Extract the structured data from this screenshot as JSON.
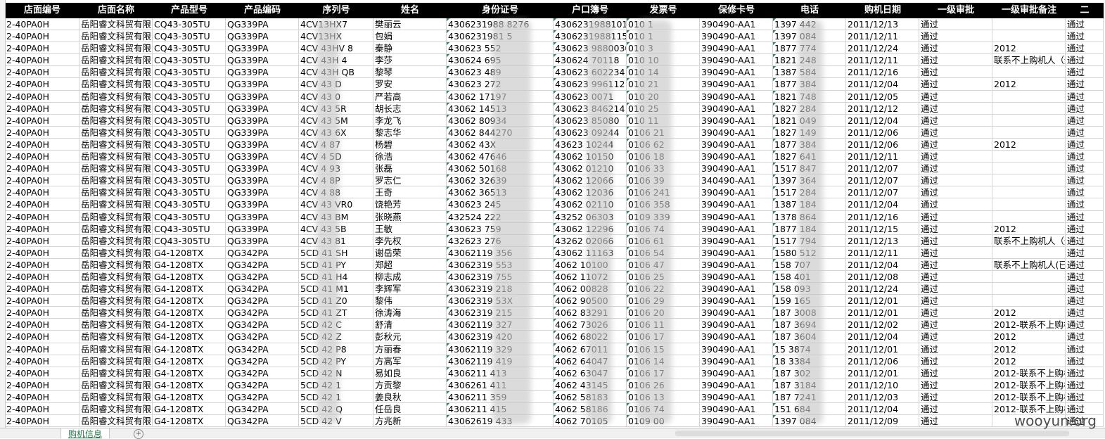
{
  "columns": [
    "店面编号",
    "店面名称",
    "产品型号",
    "产品编码",
    "序列号",
    "姓名",
    "身份证号",
    "户口簿号",
    "发票号",
    "保修卡号",
    "电话",
    "购机日期",
    "一级审批",
    "一级审批备注",
    "二"
  ],
  "rows": [
    [
      "2-40PA0H",
      "岳阳睿文科贸有限",
      "CQ43-305TU",
      "QG339PA",
      "4CV13HX7",
      "樊丽云",
      "4306231988  8276",
      "430623198810182",
      "010  1",
      "390490-AA1",
      "1397   442",
      "2011/12/13",
      "通过",
      "",
      "通过"
    ],
    [
      "2-40PA0H",
      "岳阳睿文科贸有限",
      "CQ43-305TU",
      "QG339PA",
      "4CV13HX",
      "包娟",
      "4306231981  5",
      "430623198811563",
      "010  1",
      "390490-AA1",
      "1397   084",
      "2011/12/11",
      "通过",
      "",
      "通过"
    ],
    [
      "2-40PA0H",
      "岳阳睿文科贸有限",
      "CQ43-305TU",
      "QG339PA",
      "4CV 43HV 8",
      "秦静",
      "430623  552",
      "430623  9880030",
      "010  3",
      "390490-AA1",
      "1877   774",
      "2011/12/24",
      "通过",
      "2012",
      "通过"
    ],
    [
      "2-40PA0H",
      "岳阳睿文科贸有限",
      "CQ43-305TU",
      "QG339PA",
      "4CV 43H 4",
      "李莎",
      "430624  695",
      "430624  70118",
      "010  10",
      "390490-AA1",
      "1821   248",
      "2011/12/11",
      "通过",
      "联系不上购机人（通",
      "通过"
    ],
    [
      "2-40PA0H",
      "岳阳睿文科贸有限",
      "CQ43-305TU",
      "QG339PA",
      "4CV 43H QB",
      "黎琴",
      "430623  489",
      "430623  602234",
      "010  14",
      "390490-AA1",
      "1387   584",
      "2011/12/16",
      "通过",
      "",
      "通过"
    ],
    [
      "2-40PA0H",
      "岳阳睿文科贸有限",
      "CQ43-305TU",
      "QG339PA",
      "4CV 43  D",
      "罗安",
      "430623  272",
      "430623  996112",
      "010  21",
      "390490-AA1",
      "1877   384",
      "2011/12/04",
      "通过",
      "2012",
      "通过"
    ],
    [
      "2-40PA0H",
      "岳阳睿文科贸有限",
      "CQ43-305TU",
      "QG339PA",
      "4CV 43  0",
      "严若高",
      "43062  17197",
      "430623  0071",
      "010  20",
      "390490-AA1",
      "1821   748",
      "2011/12/05",
      "通过",
      "",
      "通过"
    ],
    [
      "2-40PA0H",
      "岳阳睿文科贸有限",
      "CQ43-305TU",
      "QG339PA",
      "4CV 43  5R",
      "胡长志",
      "43062  14513",
      "430623  846214",
      "010  25",
      "390490-AA1",
      "1827   284",
      "2011/12/12",
      "通过",
      "",
      "通过"
    ],
    [
      "2-40PA0H",
      "岳阳睿文科贸有限",
      "CQ43-305TU",
      "QG339PA",
      "4CV 43  5M",
      "李龙飞",
      "43062  80934",
      "430623  85080",
      "010  11",
      "390490-AA1",
      "1821   049",
      "2011/12/04",
      "通过",
      "",
      "通过"
    ],
    [
      "2-40PA0H",
      "岳阳睿文科贸有限",
      "CQ43-305TU",
      "QG339PA",
      "4CV 43  6X",
      "黎志华",
      "43062  844270",
      "430623  09244",
      "0106  21",
      "390490-AA1",
      "1827   149",
      "2011/12/06",
      "通过",
      "",
      "通过"
    ],
    [
      "2-40PA0H",
      "岳阳睿文科贸有限",
      "CQ43-305TU",
      "QG339PA",
      "4CV 4  87",
      "杨碧",
      "43062  43X",
      "43623  10244",
      "0106  62",
      "390490-AA1",
      "1877   384",
      "2011/12/06",
      "通过",
      "2012",
      "通过"
    ],
    [
      "2-40PA0H",
      "岳阳睿文科贸有限",
      "CQ43-305TU",
      "QG339PA",
      "4CV 4  5D",
      "徐浩",
      "43062  47646",
      "43062  10150",
      "0106  18",
      "390490-AA1",
      "1827   641",
      "2011/12/11",
      "通过",
      "",
      "通过"
    ],
    [
      "2-40PA0H",
      "岳阳睿文科贸有限",
      "CQ43-305TU",
      "QG339PA",
      "4CV 4  93",
      "张磊",
      "43062  50168",
      "43062  01210",
      "0106  33",
      "390490-AA1",
      "1517   847",
      "2011/12/07",
      "通过",
      "",
      "通过"
    ],
    [
      "2-40PA0H",
      "岳阳睿文科贸有限",
      "CQ43-305TU",
      "QG339PA",
      "4CV 4  8P",
      "罗志仁",
      "43062  32639",
      "43062  12066",
      "0106  39",
      "340490-AA1",
      "1397   364",
      "2011/12/07",
      "通过",
      "",
      "通过"
    ],
    [
      "2-40PA0H",
      "岳阳睿文科贸有限",
      "CQ43-305TU",
      "QG339PA",
      "4CV 4  88",
      "王奇",
      "43062  36513",
      "43062  12036",
      "0106  241",
      "390490-AA1",
      "1517   284",
      "2011/12/07",
      "通过",
      "",
      "通过"
    ],
    [
      "2-40PA0H",
      "岳阳睿文科贸有限",
      "CQ43-305TU",
      "QG339PA",
      "4CV 43  VR0",
      "饶艳芳",
      "430623  245",
      "43062  02110",
      "0106  358",
      "390490-AA1",
      "1387   184",
      "2011/12/04",
      "通过",
      "",
      "通过"
    ],
    [
      "2-40PA0H",
      "岳阳睿文科贸有限",
      "CQ43-305TU",
      "QG339PA",
      "4CV 43  BM",
      "张晓燕",
      "432524  222",
      "43252  06303",
      "0109  339",
      "390490-AA1",
      "1378   864",
      "2011/12/16",
      "通过",
      "",
      "通过"
    ],
    [
      "2-40PA0H",
      "岳阳睿文科贸有限",
      "CQ43-305TU",
      "QG339PA",
      "4CV 43  5B",
      "王敏",
      "430623  759",
      "43062  12296",
      "0106  74",
      "390490-AA1",
      "1877   184",
      "2011/12/15",
      "通过",
      "2012",
      "通过"
    ],
    [
      "2-40PA0H",
      "岳阳睿文科贸有限",
      "CQ43-305TU",
      "QG339PA",
      "4CV 43  81",
      "李先权",
      "432623  276",
      "43262  02066",
      "0106  61",
      "390490-AA1",
      "1517   794",
      "2011/12/13",
      "通过",
      "联系不上购机人（通",
      "通过"
    ],
    [
      "2-40PA0H",
      "岳阳睿文科贸有限",
      "G4-1208TX",
      "QG342PA",
      "5CD 41  SH",
      "谢岳荣",
      "43062119  356",
      "43062  11163",
      "0106  54",
      "390490-AA1",
      "1580   512",
      "2011/12/11",
      "通过",
      "",
      "通过"
    ],
    [
      "2-40PA0H",
      "岳阳睿文科贸有限",
      "G4-1208TX",
      "QG342PA",
      "5CD 41  PY",
      "郑超",
      "43062319  553",
      "4062  10100",
      "0106  47",
      "390490-AA1",
      "158   707",
      "2011/12/04",
      "通过",
      "联系不上购机人(已",
      "通过"
    ],
    [
      "2-40PA0H",
      "岳阳睿文科贸有限",
      "G4-1208TX",
      "QG342PA",
      "5CD 41  H4",
      "柳志成",
      "43062319  755",
      "4062  11072",
      "0106  25",
      "390490-AA1",
      "158   401",
      "2011/12/08",
      "通过",
      "",
      "通过"
    ],
    [
      "2-40PA0H",
      "岳阳睿文科贸有限",
      "G4-1208TX",
      "QG342PA",
      "5CD 41  M1",
      "李辉军",
      "43062319  218",
      "4062  00828",
      "0106  22",
      "390490-AA1",
      "158   093",
      "2011/12/24",
      "通过",
      "",
      "通过"
    ],
    [
      "2-40PA0H",
      "岳阳睿文科贸有限",
      "G4-1208TX",
      "QG342PA",
      "5CD 41  Z0",
      "黎伟",
      "43062319  53X",
      "4062  90500",
      "0106  29",
      "390490-AA1",
      "159   165",
      "2011/12/01",
      "通过",
      "",
      "通过"
    ],
    [
      "2-40PA0H",
      "岳阳睿文科贸有限",
      "G4-1208TX",
      "QG342PA",
      "5CD 41  ZT",
      "徐涛海",
      "43062319  215",
      "4062  83291",
      "0106  20",
      "390490-AA1",
      "187   3008",
      "2011/12/01",
      "通过",
      "2012",
      "通过"
    ],
    [
      "2-40PA0H",
      "岳阳睿文科贸有限",
      "G4-1208TX",
      "QG342PA",
      "5CD 42  C",
      "舒清",
      "43062119  327",
      "4062  73026",
      "0106  11",
      "390490-AA1",
      "187   3694",
      "2011/12/02",
      "通过",
      "2012-联系不上购机",
      "通过"
    ],
    [
      "2-40PA0H",
      "岳阳睿文科贸有限",
      "G4-1208TX",
      "QG342PA",
      "5CD 42  Z",
      "彭秋元",
      "43062319  420",
      "4062  68022",
      "0106  17",
      "390490-AA1",
      "187   3604",
      "2011/12/04",
      "通过",
      "2012",
      "通过"
    ],
    [
      "2-40PA0H",
      "岳阳睿文科贸有限",
      "G4-1208TX",
      "QG342PA",
      "5CD 42  P8",
      "方丽春",
      "43062119  329",
      "4062  67011",
      "0106  15",
      "390490-AA1",
      "15   3874",
      "2011/12/01",
      "通过",
      "2012",
      "通过"
    ],
    [
      "2-40PA0H",
      "岳阳睿文科贸有限",
      "G4-1208TX",
      "QG342PA",
      "5CD 42  PY",
      "方高军",
      "43062119  419",
      "4062  64047",
      "0106  14",
      "390490-AA1",
      "18   3384",
      "2011/12/06",
      "通过",
      "2012",
      "通过"
    ],
    [
      "2-40PA0H",
      "岳阳睿文科贸有限",
      "G4-1208TX",
      "QG342PA",
      "5CD 42  N",
      "易如良",
      "4306211  413",
      "4062  63047",
      "0106  17",
      "390490-AA1",
      "187   302",
      "2011/12/01",
      "通过",
      "2012-联系不上购机",
      "通过"
    ],
    [
      "2-40PA0H",
      "岳阳睿文科贸有限",
      "G4-1208TX",
      "QG342PA",
      "5CD 42  1",
      "方贡黎",
      "4306261  411",
      "4062  43145",
      "0106  26",
      "390490-AA1",
      "187   3184",
      "2011/12/10",
      "通过",
      "2012-联系不上购机",
      "通过"
    ],
    [
      "2-40PA0H",
      "岳阳睿文科贸有限",
      "G4-1208TX",
      "QG342PA",
      "5CD 42  1",
      "姜良秋",
      "4306211  359",
      "4062  58183",
      "0106  13",
      "390490-AA1",
      "187   7241",
      "2011/12/03",
      "通过",
      "2012-联系不上购机",
      "通过"
    ],
    [
      "2-40PA0H",
      "岳阳睿文科贸有限",
      "G4-1208TX",
      "QG342PA",
      "5CD 42  Q",
      "任岳良",
      "4306211  415",
      "4062  58186",
      "0106  74",
      "390490-AA1",
      "151   684",
      "2011/12/04",
      "通过",
      "2012-联系不上购机",
      "通过"
    ],
    [
      "2-40PA0H",
      "岳阳睿文科贸有限",
      "G4-1208TX",
      "QG342PA",
      "5CD 42  V",
      "方兆新",
      "43062619  433",
      "4062  70105",
      "0109  00",
      "390490-AA1",
      "1397   084",
      "2011/12/09",
      "通过",
      "",
      "通过"
    ]
  ],
  "sheet_tab": "购机信息",
  "watermark": "wooyun.org"
}
